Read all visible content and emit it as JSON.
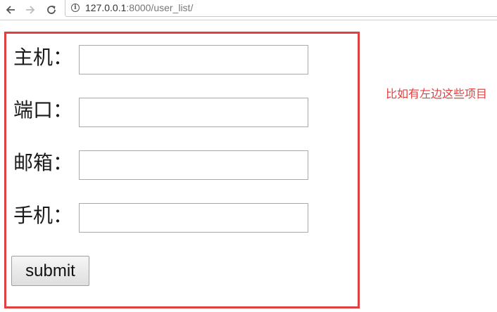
{
  "browser": {
    "url_host": "127.0.0.1",
    "url_path": ":8000/user_list/",
    "info_glyph": "i"
  },
  "form": {
    "fields": [
      {
        "label": "主机：",
        "value": ""
      },
      {
        "label": "端口：",
        "value": ""
      },
      {
        "label": "邮箱：",
        "value": ""
      },
      {
        "label": "手机：",
        "value": ""
      }
    ],
    "submit_label": "submit"
  },
  "annotation": {
    "text": "比如有左边这些项目"
  },
  "colors": {
    "highlight": "#e04040"
  },
  "icons": [
    "back-arrow-icon",
    "forward-arrow-icon",
    "reload-icon",
    "info-icon"
  ]
}
